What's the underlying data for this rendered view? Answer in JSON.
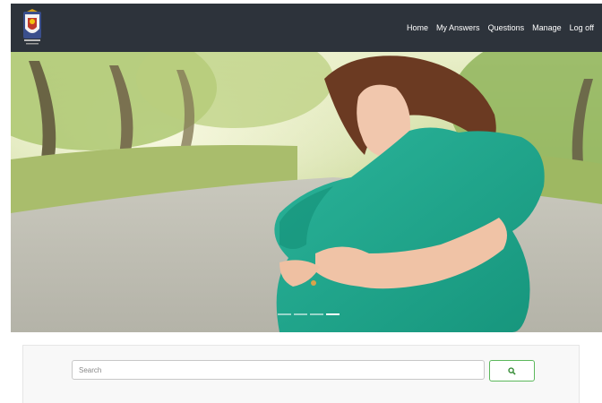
{
  "nav": {
    "links": [
      {
        "label": "Home"
      },
      {
        "label": "My Answers"
      },
      {
        "label": "Questions"
      },
      {
        "label": "Manage"
      },
      {
        "label": "Log off"
      }
    ],
    "background": "#2d333b",
    "link_color": "#ffffff"
  },
  "logo": {
    "icon": "crest-logo-icon"
  },
  "hero": {
    "slide_count": 4,
    "active_slide": 4
  },
  "search": {
    "placeholder": "Search",
    "value": "",
    "button_icon": "search-icon",
    "button_color": "#5cb85c"
  }
}
